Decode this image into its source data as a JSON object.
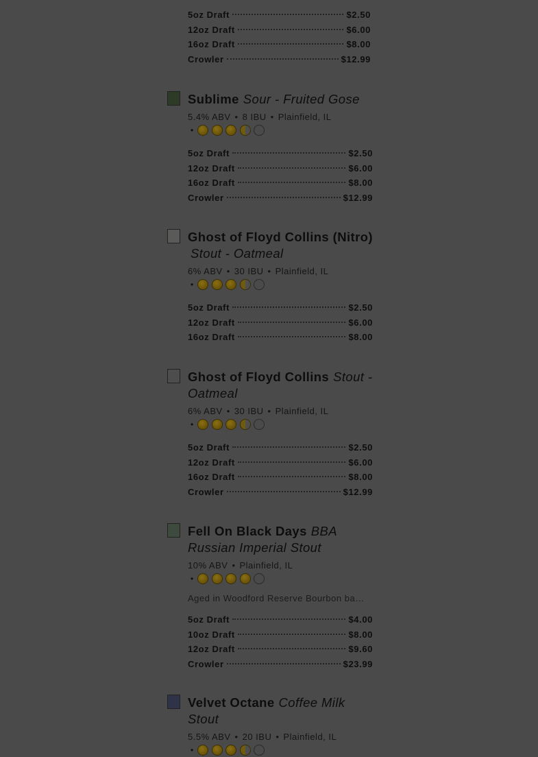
{
  "top_prices": [
    {
      "size": "5oz Draft",
      "price": "$2.50"
    },
    {
      "size": "12oz Draft",
      "price": "$6.00"
    },
    {
      "size": "16oz Draft",
      "price": "$8.00"
    },
    {
      "size": "Crowler",
      "price": "$12.99"
    }
  ],
  "beers": [
    {
      "name": "Sublime",
      "style": "Sour - Fruited Gose",
      "abv": "5.4% ABV",
      "ibu": "8 IBU",
      "location": "Plainfield, IL",
      "rating": 3.75,
      "description": "",
      "prices": [
        {
          "size": "5oz Draft",
          "price": "$2.50"
        },
        {
          "size": "12oz Draft",
          "price": "$6.00"
        },
        {
          "size": "16oz Draft",
          "price": "$8.00"
        },
        {
          "size": "Crowler",
          "price": "$12.99"
        }
      ]
    },
    {
      "name": "Ghost of Floyd Collins (Nitro)",
      "style": "Stout - Oatmeal",
      "abv": "6% ABV",
      "ibu": "30 IBU",
      "location": "Plainfield, IL",
      "rating": 3.5,
      "description": "",
      "prices": [
        {
          "size": "5oz Draft",
          "price": "$2.50"
        },
        {
          "size": "12oz Draft",
          "price": "$6.00"
        },
        {
          "size": "16oz Draft",
          "price": "$8.00"
        }
      ]
    },
    {
      "name": "Ghost of Floyd Collins",
      "style": "Stout - Oatmeal",
      "abv": "6% ABV",
      "ibu": "30 IBU",
      "location": "Plainfield, IL",
      "rating": 3.5,
      "description": "",
      "prices": [
        {
          "size": "5oz Draft",
          "price": "$2.50"
        },
        {
          "size": "12oz Draft",
          "price": "$6.00"
        },
        {
          "size": "16oz Draft",
          "price": "$8.00"
        },
        {
          "size": "Crowler",
          "price": "$12.99"
        }
      ]
    },
    {
      "name": "Fell On Black Days",
      "style": "BBA Russian Imperial Stout",
      "abv": "10% ABV",
      "ibu": "",
      "location": "Plainfield, IL",
      "rating": 4,
      "description": "Aged in Woodford Reserve Bourbon barr…",
      "prices": [
        {
          "size": "5oz Draft",
          "price": "$4.00"
        },
        {
          "size": "10oz Draft",
          "price": "$8.00"
        },
        {
          "size": "12oz Draft",
          "price": "$9.60"
        },
        {
          "size": "Crowler",
          "price": "$23.99"
        }
      ]
    },
    {
      "name": "Velvet Octane",
      "style": "Coffee Milk Stout",
      "abv": "5.5% ABV",
      "ibu": "20 IBU",
      "location": "Plainfield, IL",
      "rating": 3.75,
      "description": "",
      "prices": []
    }
  ],
  "separator": "•"
}
